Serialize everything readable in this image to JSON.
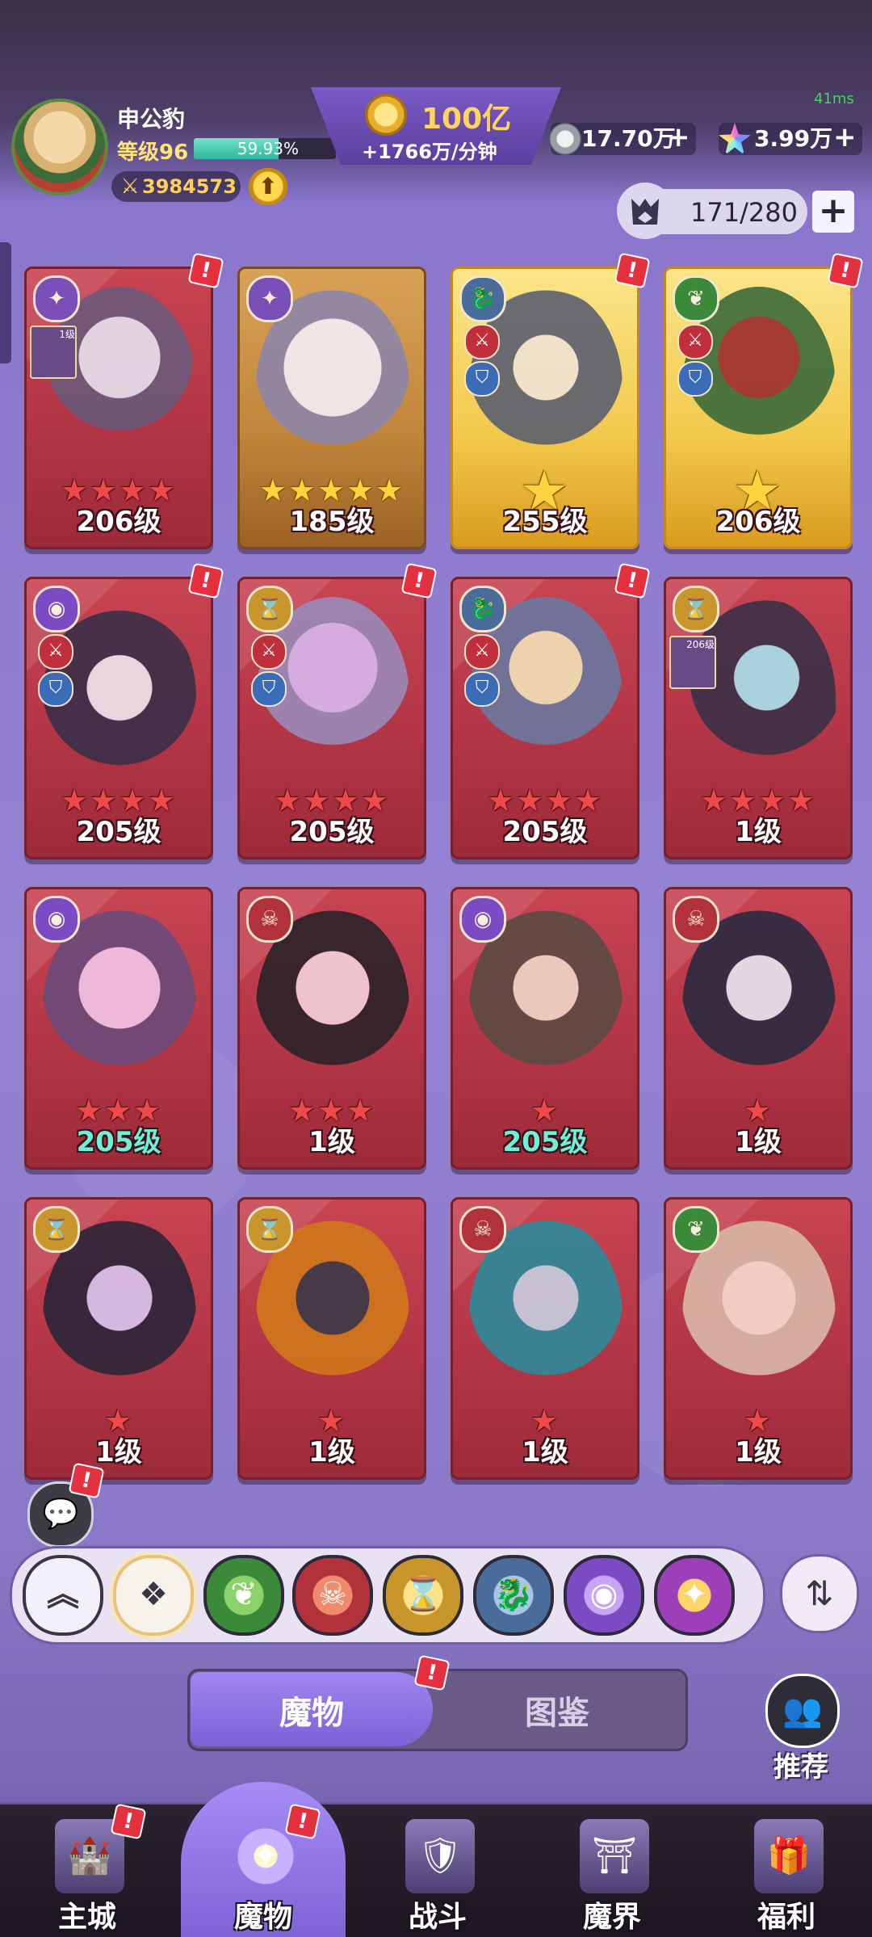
{
  "header": {
    "username": "申公豹",
    "level_label": "等级96",
    "xp_percent_text": "59.93%",
    "xp_fraction": 0.5993,
    "power_value": "3984573",
    "gold_amount": "100亿",
    "gold_rate": "+1766万/分钟",
    "ping": "41ms",
    "resource1_value": "17.70万",
    "resource2_value": "3.99万",
    "resource_plus": "+",
    "capacity": "171/280",
    "capacity_plus": "+"
  },
  "icons": {
    "avatar": "avatar",
    "power": "sword-icon",
    "upgrade": "arrow-up-icon",
    "gold": "gold-coin-icon",
    "resource1": "silver-coin-icon",
    "resource2": "star-gem-icon",
    "capacity": "monster-bag-icon",
    "chat": "chat-bubbles-icon",
    "sort": "sort-icon",
    "recommend": "recommend-group-icon"
  },
  "cards": [
    {
      "level": "206级",
      "stars": "★★★★",
      "alert": "!"
    },
    {
      "level": "185级",
      "stars": "★★★★★",
      "alert": ""
    },
    {
      "level": "255级",
      "stars": "★",
      "alert": "!"
    },
    {
      "level": "206级",
      "stars": "★",
      "alert": "!"
    },
    {
      "level": "205级",
      "stars": "★★★★",
      "alert": "!"
    },
    {
      "level": "205级",
      "stars": "★★★★",
      "alert": "!"
    },
    {
      "level": "205级",
      "stars": "★★★★",
      "alert": "!"
    },
    {
      "level": "1级",
      "stars": "★★★★",
      "alert": ""
    },
    {
      "level": "205级",
      "stars": "★★★",
      "alert": ""
    },
    {
      "level": "1级",
      "stars": "★★★",
      "alert": ""
    },
    {
      "level": "205级",
      "stars": "★",
      "alert": ""
    },
    {
      "level": "1级",
      "stars": "★",
      "alert": ""
    },
    {
      "level": "1级",
      "stars": "★",
      "alert": ""
    },
    {
      "level": "1级",
      "stars": "★",
      "alert": ""
    },
    {
      "level": "1级",
      "stars": "★",
      "alert": ""
    },
    {
      "level": "1级",
      "stars": "★",
      "alert": ""
    }
  ],
  "mini_badges": {
    "card1": "1级",
    "card8": "206级"
  },
  "alert_mark": "!",
  "tabs": {
    "active": "魔物",
    "inactive": "图鉴"
  },
  "recommend_label": "推荐",
  "filters": [
    "collapse-icon",
    "all-factions-icon",
    "nature-faction-icon",
    "demon-faction-icon",
    "hourglass-faction-icon",
    "dragon-faction-icon",
    "eye-faction-icon",
    "arcane-faction-icon"
  ],
  "nav": {
    "main_city": "主城",
    "monsters": "魔物",
    "battle": "战斗",
    "demon_realm": "魔界",
    "welfare": "福利"
  },
  "colors": {
    "card_red": "#b33646",
    "card_gold": "#f2c94c",
    "nav_active": "#8f76e2",
    "xp_fill": "#2fb89d",
    "gold_text": "#ffd45c"
  }
}
